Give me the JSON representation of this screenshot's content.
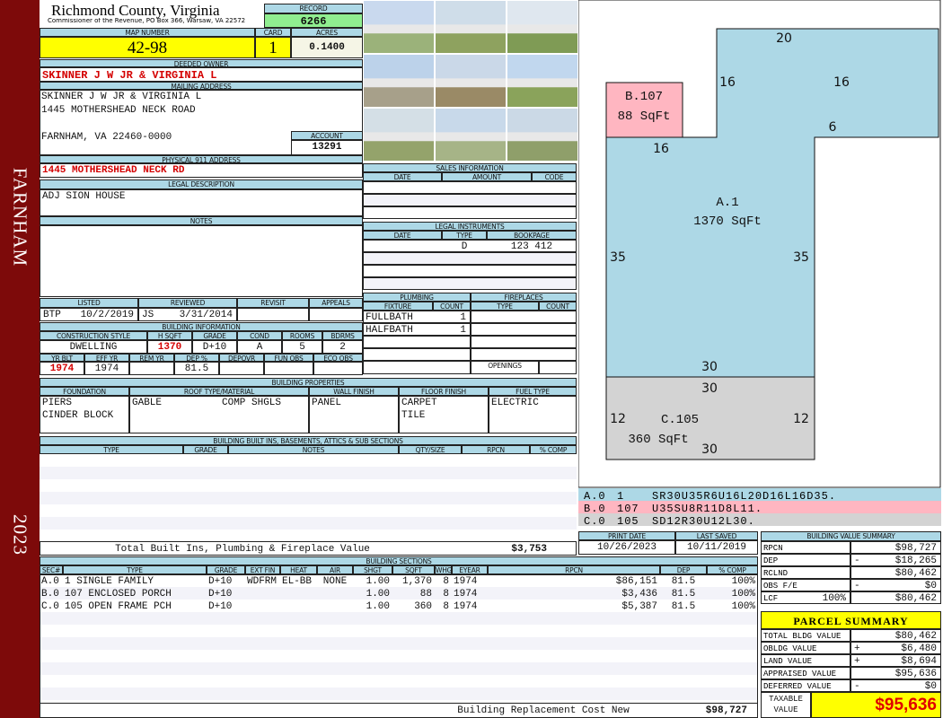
{
  "sidebar": {
    "city": "FARNHAM",
    "year": "2023"
  },
  "header": {
    "county": "Richmond County, Virginia",
    "subtitle": "Commissioner of the Revenue, PO Box 366, Warsaw, VA 22572",
    "record_label": "RECORD",
    "record": "6266"
  },
  "parcel": {
    "map_number_label": "MAP NUMBER",
    "map_number": "42-98",
    "card_label": "CARD",
    "card": "1",
    "acres_label": "ACRES",
    "acres": "0.1400"
  },
  "owner": {
    "label": "DEEDED OWNER",
    "name": "SKINNER J W JR & VIRGINIA L"
  },
  "mailing": {
    "label": "MAILING ADDRESS",
    "line1": "SKINNER J W JR & VIRGINIA L",
    "line2": "1445 MOTHERSHEAD NECK ROAD",
    "line3": "FARNHAM, VA 22460-0000"
  },
  "account": {
    "label": "ACCOUNT",
    "value": "13291"
  },
  "physical": {
    "label": "PHYSICAL 911 ADDRESS",
    "value": "1445 MOTHERSHEAD NECK RD"
  },
  "legal": {
    "label": "LEGAL DESCRIPTION",
    "value": "ADJ SION HOUSE"
  },
  "notes": {
    "label": "NOTES"
  },
  "review": {
    "listed_label": "LISTED",
    "listed_by": "BTP",
    "listed_date": "10/2/2019",
    "reviewed_label": "REVIEWED",
    "reviewed_by": "JS",
    "reviewed_date": "3/31/2014",
    "revisit_label": "REVISIT",
    "appeals_label": "APPEALS"
  },
  "building_info": {
    "title": "BUILDING INFORMATION",
    "labels": [
      "CONSTRUCTION STYLE",
      "H SQFT",
      "GRADE",
      "COND",
      "ROOMS",
      "BDRMS"
    ],
    "values": [
      "DWELLING",
      "1370",
      "D+10",
      "A",
      "5",
      "2"
    ],
    "labels2": [
      "YR BLT",
      "EFF YR",
      "REM YR",
      "DEP %",
      "DEPOVR",
      "FUN OBS",
      "ECO OBS"
    ],
    "values2": [
      "1974",
      "1974",
      "",
      "81.5",
      "",
      "",
      ""
    ]
  },
  "properties": {
    "title": "BUILDING PROPERTIES",
    "labels": [
      "FOUNDATION",
      "ROOF TYPE/MATERIAL",
      "WALL FINISH",
      "FLOOR FINISH",
      "FUEL TYPE"
    ],
    "foundation": [
      "PIERS",
      "CINDER BLOCK"
    ],
    "roof_type": "GABLE",
    "roof_material": "COMP SHGLS",
    "wall": "PANEL",
    "floor": [
      "CARPET",
      "TILE"
    ],
    "fuel": "ELECTRIC"
  },
  "builtins": {
    "title": "BUILDING BUILT INS, BASEMENTS, ATTICS & SUB SECTIONS",
    "labels": [
      "TYPE",
      "GRADE",
      "NOTES",
      "QTY/SIZE",
      "RPCN",
      "% COMP"
    ],
    "total_label": "Total Built Ins, Plumbing & Fireplace Value",
    "total": "$3,753"
  },
  "sections": {
    "title": "BUILDING SECTIONS",
    "labels": [
      "SEC#",
      "TYPE",
      "GRADE",
      "EXT FIN",
      "HEAT",
      "AIR",
      "SHGT",
      "SQFT",
      "WHGT",
      "EYEAR",
      "RPCN",
      "DEP",
      "% COMP"
    ],
    "rows": [
      [
        "A.0",
        "1 SINGLE FAMILY",
        "D+10",
        "WDFRM",
        "EL-BB",
        "NONE",
        "1.00",
        "1,370",
        "8",
        "1974",
        "$86,151",
        "81.5",
        "100%"
      ],
      [
        "B.0",
        "107 ENCLOSED PORCH",
        "D+10",
        "",
        "",
        "",
        "1.00",
        "88",
        "8",
        "1974",
        "$3,436",
        "81.5",
        "100%"
      ],
      [
        "C.0",
        "105 OPEN FRAME PCH",
        "D+10",
        "",
        "",
        "",
        "1.00",
        "360",
        "8",
        "1974",
        "$5,387",
        "81.5",
        "100%"
      ]
    ],
    "total_label": "Building Replacement Cost New",
    "total": "$98,727"
  },
  "sales": {
    "title": "SALES INFORMATION",
    "labels": [
      "DATE",
      "AMOUNT",
      "CODE"
    ]
  },
  "legal_instruments": {
    "title": "LEGAL INSTRUMENTS",
    "labels": [
      "DATE",
      "TYPE",
      "BOOKPAGE"
    ],
    "rows": [
      [
        "",
        "D",
        "123 412"
      ]
    ]
  },
  "plumbing": {
    "title": "PLUMBING",
    "labels": [
      "FIXTURE",
      "COUNT"
    ],
    "rows": [
      [
        "FULLBATH",
        "1"
      ],
      [
        "HALFBATH",
        "1"
      ]
    ]
  },
  "fireplaces": {
    "title": "FIREPLACES",
    "labels": [
      "TYPE",
      "COUNT"
    ],
    "openings_label": "OPENINGS"
  },
  "sketch": {
    "areas": [
      {
        "name": "A.1",
        "sqft": "1370 SqFt",
        "color": "#add8e6"
      },
      {
        "name": "B.107",
        "sqft": "88 SqFt",
        "color": "#ffb6c1"
      },
      {
        "name": "C.105",
        "sqft": "360 SqFt",
        "color": "#d3d3d3"
      }
    ],
    "dimensions": [
      "20",
      "16",
      "16",
      "6",
      "16",
      "35",
      "35",
      "30",
      "30",
      "12",
      "12",
      "30"
    ],
    "legend": [
      {
        "sec": "A.0",
        "code": "1",
        "path": "SR30U35R6U16L20D16L16D35.",
        "color": "#add8e6"
      },
      {
        "sec": "B.0",
        "code": "107",
        "path": "U35SU8R11D8L11.",
        "color": "#ffb6c1"
      },
      {
        "sec": "C.0",
        "code": "105",
        "path": "SD12R30U12L30.",
        "color": "#d3d3d3"
      }
    ]
  },
  "dates": {
    "print_label": "PRINT DATE",
    "print": "10/26/2023",
    "saved_label": "LAST SAVED",
    "saved": "10/11/2019"
  },
  "value_summary": {
    "title": "BUILDING VALUE SUMMARY",
    "rows": [
      {
        "label": "RPCN",
        "sign": "",
        "value": "$98,727"
      },
      {
        "label": "DEP",
        "sign": "-",
        "value": "$18,265"
      },
      {
        "label": "RCLND",
        "sign": "",
        "value": "$80,462"
      },
      {
        "label": "OBS F/E",
        "sign": "-",
        "value": "$0"
      },
      {
        "label": "LCF",
        "pct": "100%",
        "sign": "",
        "value": "$80,462"
      }
    ]
  },
  "parcel_summary": {
    "title": "PARCEL SUMMARY",
    "rows": [
      {
        "label": "TOTAL BLDG VALUE",
        "sign": "",
        "value": "$80,462"
      },
      {
        "label": "OBLDG VALUE",
        "sign": "+",
        "value": "$6,480"
      },
      {
        "label": "LAND VALUE",
        "sign": "+",
        "value": "$8,694"
      },
      {
        "label": "APPRAISED VALUE",
        "sign": "",
        "value": "$95,636"
      },
      {
        "label": "DEFERRED VALUE",
        "sign": "-",
        "value": "$0"
      }
    ],
    "taxable_label_1": "TAXABLE",
    "taxable_label_2": "VALUE",
    "taxable": "$95,636"
  },
  "colors": {
    "sidebar": "#7d0a0a",
    "header": "#add8e6",
    "highlight": "#ffff00",
    "record": "#90ee90",
    "emphasis": "#d40000"
  }
}
